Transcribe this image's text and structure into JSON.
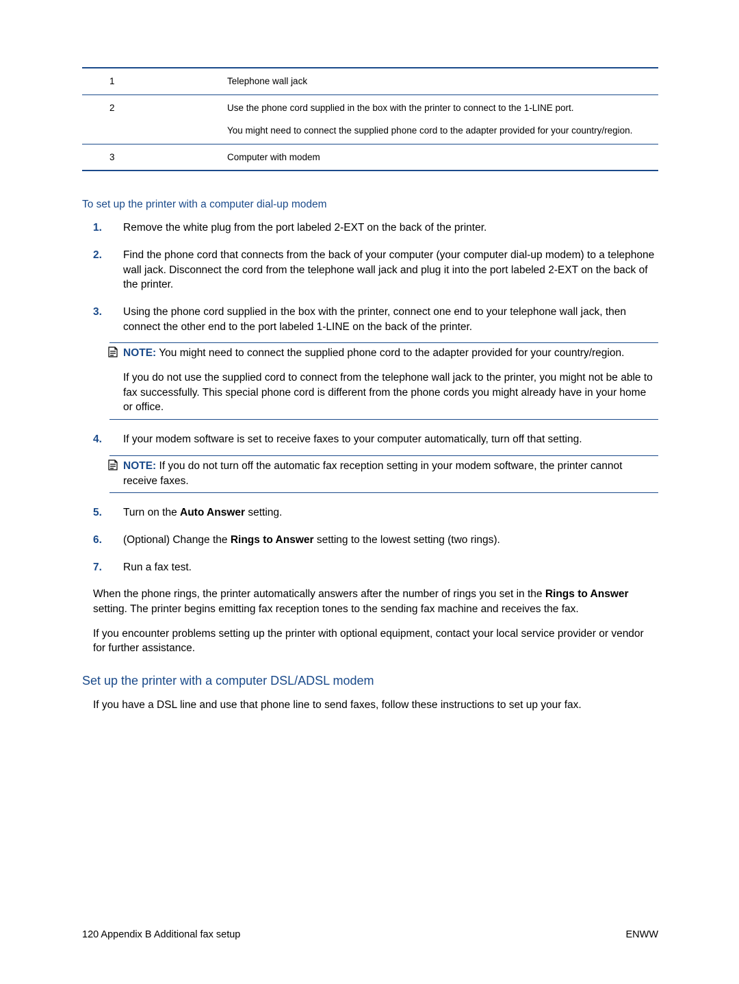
{
  "table": {
    "rows": [
      {
        "num": "1",
        "cells": [
          "Telephone wall jack"
        ]
      },
      {
        "num": "2",
        "cells": [
          "Use the phone cord supplied in the box with the printer to connect to the 1-LINE port.",
          "You might need to connect the supplied phone cord to the adapter provided for your country/region."
        ]
      },
      {
        "num": "3",
        "cells": [
          "Computer with modem"
        ]
      }
    ]
  },
  "section1": {
    "heading": "To set up the printer with a computer dial-up modem",
    "steps": [
      {
        "n": "1.",
        "text": "Remove the white plug from the port labeled 2-EXT on the back of the printer."
      },
      {
        "n": "2.",
        "text": "Find the phone cord that connects from the back of your computer (your computer dial-up modem) to a telephone wall jack. Disconnect the cord from the telephone wall jack and plug it into the port labeled 2-EXT on the back of the printer."
      },
      {
        "n": "3.",
        "text": "Using the phone cord supplied in the box with the printer, connect one end to your telephone wall jack, then connect the other end to the port labeled 1-LINE on the back of the printer.",
        "note": {
          "label": "NOTE:",
          "p1a": "You might need to connect the supplied phone cord to the adapter provided for your country/region.",
          "p2": "If you do not use the supplied cord to connect from the telephone wall jack to the printer, you might not be able to fax successfully. This special phone cord is different from the phone cords you might already have in your home or office."
        }
      },
      {
        "n": "4.",
        "text": "If your modem software is set to receive faxes to your computer automatically, turn off that setting.",
        "note": {
          "label": "NOTE:",
          "p1a": "If you do not turn off the automatic fax reception setting in your modem software, the printer cannot receive faxes."
        }
      },
      {
        "n": "5.",
        "pre": "Turn on the ",
        "bold": "Auto Answer",
        "post": " setting."
      },
      {
        "n": "6.",
        "pre": "(Optional) Change the ",
        "bold": "Rings to Answer",
        "post": " setting to the lowest setting (two rings)."
      },
      {
        "n": "7.",
        "text": "Run a fax test."
      }
    ],
    "closing": {
      "p1_pre": "When the phone rings, the printer automatically answers after the number of rings you set in the ",
      "p1_bold": "Rings to Answer",
      "p1_post": " setting. The printer begins emitting fax reception tones to the sending fax machine and receives the fax.",
      "p2": "If you encounter problems setting up the printer with optional equipment, contact your local service provider or vendor for further assistance."
    }
  },
  "section2": {
    "heading": "Set up the printer with a computer DSL/ADSL modem",
    "intro": "If you have a DSL line and use that phone line to send faxes, follow these instructions to set up your fax."
  },
  "footer": {
    "left": "120  Appendix B   Additional fax setup",
    "right": "ENWW"
  }
}
